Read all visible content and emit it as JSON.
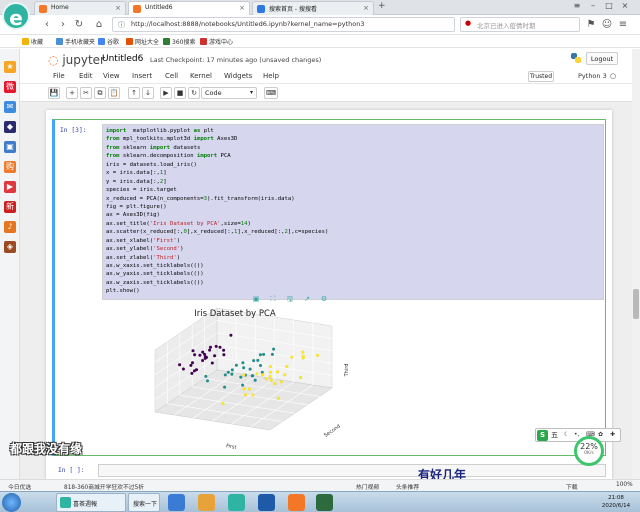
{
  "browser": {
    "tabs": [
      {
        "label": "Home",
        "active": false
      },
      {
        "label": "Untitled6",
        "active": true
      },
      {
        "label": "搜索首页 - 搜搜看",
        "active": false
      }
    ],
    "window_controls": [
      "≡",
      "–",
      "□",
      "×"
    ],
    "url": "http://localhost:8888/notebooks/Untitled6.ipynb?kernel_name=python3",
    "search_placeholder": "北京已进入疫情时期",
    "bookmarks": [
      {
        "label": "收藏",
        "color": "#f4b400"
      },
      {
        "label": "手机收藏夹",
        "color": "#4a90d9"
      },
      {
        "label": "谷歌",
        "color": "#4285f4"
      },
      {
        "label": "网址大全",
        "color": "#e65100"
      },
      {
        "label": "360搜索",
        "color": "#2e7d32"
      },
      {
        "label": "游戏中心",
        "color": "#d32f2f"
      }
    ]
  },
  "jupyter": {
    "logo_text": "jupyter",
    "notebook_title": "Untitled6",
    "checkpoint": "Last Checkpoint: 17 minutes ago (unsaved changes)",
    "logout_label": "Logout",
    "menu": [
      "File",
      "Edit",
      "View",
      "Insert",
      "Cell",
      "Kernel",
      "Widgets",
      "Help"
    ],
    "trusted_label": "Trusted",
    "kernel_label": "Python 3",
    "toolbar_icons": [
      {
        "name": "save-icon",
        "glyph": "💾"
      },
      {
        "name": "add-cell-icon",
        "glyph": "+"
      },
      {
        "name": "cut-icon",
        "glyph": "✂"
      },
      {
        "name": "copy-icon",
        "glyph": "⧉"
      },
      {
        "name": "paste-icon",
        "glyph": "📋"
      },
      {
        "name": "move-up-icon",
        "glyph": "↑"
      },
      {
        "name": "move-down-icon",
        "glyph": "↓"
      },
      {
        "name": "run-icon",
        "glyph": "▶"
      },
      {
        "name": "stop-icon",
        "glyph": "■"
      },
      {
        "name": "restart-icon",
        "glyph": "↻"
      }
    ],
    "cell_type": "Code"
  },
  "cell": {
    "prompt": "In  [3]:",
    "code": [
      [
        [
          "kw",
          "import"
        ],
        [
          "",
          "  matplotlib.pyplot "
        ],
        [
          "kw",
          "as"
        ],
        [
          "",
          " plt"
        ]
      ],
      [
        [
          "kw",
          "from"
        ],
        [
          "",
          " mpl_toolkits.mplot3d "
        ],
        [
          "kw",
          "import"
        ],
        [
          "",
          " Axes3D"
        ]
      ],
      [
        [
          "kw",
          "from"
        ],
        [
          "",
          " sklearn "
        ],
        [
          "kw",
          "import"
        ],
        [
          "",
          " datasets"
        ]
      ],
      [
        [
          "kw",
          "from"
        ],
        [
          "",
          " sklearn.decomposition "
        ],
        [
          "kw",
          "import"
        ],
        [
          "",
          " PCA"
        ]
      ],
      [
        [
          "",
          "iris = datasets.load_iris()"
        ]
      ],
      [
        [
          "",
          "x = iris.data[:,"
        ],
        [
          "num",
          "1"
        ],
        [
          "",
          "]"
        ]
      ],
      [
        [
          "",
          "y = iris.data[:,"
        ],
        [
          "num",
          "2"
        ],
        [
          "",
          "]"
        ]
      ],
      [
        [
          "",
          "species = iris.target"
        ]
      ],
      [
        [
          "",
          "x_reduced = PCA(n_components="
        ],
        [
          "num",
          "3"
        ],
        [
          "",
          ").fit_transform(iris.data)"
        ]
      ],
      [
        [
          "",
          "fig = plt.figure()"
        ]
      ],
      [
        [
          "",
          "ax = Axes3D(fig)"
        ]
      ],
      [
        [
          "",
          "ax.set_title("
        ],
        [
          "str",
          "'Iris Dataset by PCA'"
        ],
        [
          "",
          ",size="
        ],
        [
          "num",
          "14"
        ],
        [
          "",
          ")"
        ]
      ],
      [
        [
          "",
          "ax.scatter(x_reduced[:,"
        ],
        [
          "num",
          "0"
        ],
        [
          "",
          "],x_reduced[:,"
        ],
        [
          "num",
          "1"
        ],
        [
          "",
          "],x_reduced[:,"
        ],
        [
          "num",
          "2"
        ],
        [
          "",
          "],c=species)"
        ]
      ],
      [
        [
          "",
          "ax.set_xlabel("
        ],
        [
          "str",
          "'First'"
        ],
        [
          "",
          ")"
        ]
      ],
      [
        [
          "",
          "ax.set_ylabel("
        ],
        [
          "str",
          "'Second'"
        ],
        [
          "",
          ")"
        ]
      ],
      [
        [
          "",
          "ax.set_zlabel("
        ],
        [
          "str",
          "'Third'"
        ],
        [
          "",
          ")"
        ]
      ],
      [
        [
          "",
          "ax.w_xaxis.set_ticklabels(())"
        ]
      ],
      [
        [
          "",
          "ax.w_yaxis.set_ticklabels(())"
        ]
      ],
      [
        [
          "",
          "ax.w_zaxis.set_ticklabels(())"
        ]
      ],
      [
        [
          "",
          "plt.show()"
        ]
      ]
    ],
    "cell_tools": [
      "▣",
      "⛶",
      "🖫",
      "↗",
      "⚙"
    ]
  },
  "cell2": {
    "prompt": "In  [ ]:"
  },
  "chart_data": {
    "type": "scatter",
    "title": "Iris Dataset by PCA",
    "xlabel": "First",
    "ylabel": "Second",
    "zlabel": "Third",
    "ticklabels_hidden": true,
    "colors": {
      "class0": "#440154",
      "class1": "#21918c",
      "class2": "#fde725"
    },
    "series": [
      {
        "class": 0,
        "points": [
          [
            -2.68,
            0.32,
            -0.03
          ],
          [
            -2.71,
            -0.18,
            -0.21
          ],
          [
            -2.89,
            -0.14,
            0.02
          ],
          [
            -2.75,
            -0.32,
            0.03
          ],
          [
            -2.73,
            0.33,
            0.09
          ],
          [
            -2.28,
            0.74,
            0.17
          ],
          [
            -2.82,
            -0.09,
            0.26
          ],
          [
            -2.63,
            0.16,
            -0.02
          ],
          [
            -2.89,
            -0.58,
            0.02
          ],
          [
            -2.67,
            -0.11,
            -0.2
          ],
          [
            -2.51,
            0.65,
            -0.08
          ],
          [
            -2.61,
            0.01,
            0.22
          ],
          [
            -2.79,
            -0.24,
            -0.27
          ],
          [
            -3.23,
            -0.51,
            0.1
          ],
          [
            -2.64,
            1.18,
            -0.15
          ],
          [
            -2.38,
            1.34,
            0.28
          ],
          [
            -2.62,
            0.81,
            0.14
          ],
          [
            -2.65,
            0.31,
            0.03
          ],
          [
            -2.2,
            0.87,
            -0.12
          ],
          [
            -2.59,
            0.51,
            0.25
          ],
          [
            -2.31,
            0.39,
            -0.18
          ],
          [
            -2.54,
            0.43,
            0.2
          ],
          [
            -3.22,
            0.13,
            0.26
          ],
          [
            -2.3,
            0.1,
            0.13
          ],
          [
            -2.36,
            -0.04,
            0.36
          ]
        ]
      },
      {
        "class": 1,
        "points": [
          [
            1.28,
            0.69,
            0.41
          ],
          [
            0.93,
            0.32,
            0.02
          ],
          [
            1.46,
            0.5,
            0.34
          ],
          [
            0.18,
            -0.83,
            0.18
          ],
          [
            1.09,
            0.07,
            0.31
          ],
          [
            0.64,
            -0.42,
            -0.04
          ],
          [
            1.1,
            0.28,
            -0.17
          ],
          [
            -0.75,
            -1.0,
            -0.01
          ],
          [
            1.04,
            0.23,
            0.42
          ],
          [
            -0.01,
            -0.72,
            -0.28
          ],
          [
            -0.51,
            -1.26,
            0.27
          ],
          [
            0.51,
            -0.1,
            -0.13
          ],
          [
            0.26,
            -0.55,
            0.22
          ],
          [
            0.98,
            -0.12,
            -0.11
          ],
          [
            -0.17,
            -0.25,
            -0.09
          ],
          [
            0.93,
            0.47,
            0.31
          ],
          [
            0.66,
            -0.35,
            -0.33
          ],
          [
            0.23,
            -0.33,
            0.27
          ],
          [
            0.94,
            -0.54,
            0.5
          ],
          [
            0.04,
            -0.58,
            0.14
          ],
          [
            1.12,
            -0.08,
            -0.26
          ],
          [
            0.36,
            -0.07,
            0.08
          ],
          [
            1.3,
            -0.33,
            0.01
          ],
          [
            0.92,
            -0.18,
            0.13
          ],
          [
            0.71,
            0.15,
            0.24
          ]
        ]
      },
      {
        "class": 2,
        "points": [
          [
            2.53,
            -0.01,
            -0.76
          ],
          [
            1.41,
            -0.57,
            -0.3
          ],
          [
            2.62,
            0.34,
            0.11
          ],
          [
            1.97,
            -0.18,
            -0.1
          ],
          [
            2.35,
            -0.04,
            -0.29
          ],
          [
            3.4,
            0.55,
            0.35
          ],
          [
            0.52,
            -1.19,
            -0.55
          ],
          [
            2.93,
            0.35,
            0.43
          ],
          [
            2.32,
            -0.24,
            0.35
          ],
          [
            2.92,
            0.78,
            -0.42
          ],
          [
            1.66,
            0.24,
            -0.24
          ],
          [
            1.8,
            -0.22,
            0.04
          ],
          [
            2.17,
            0.22,
            -0.04
          ],
          [
            1.34,
            -0.78,
            -0.2
          ],
          [
            1.59,
            -0.54,
            -0.49
          ],
          [
            1.9,
            0.12,
            -0.29
          ],
          [
            1.95,
            0.04,
            0.01
          ],
          [
            3.49,
            1.18,
            0.16
          ],
          [
            3.8,
            0.26,
            0.57
          ],
          [
            1.3,
            -0.76,
            0.23
          ],
          [
            2.43,
            0.38,
            -0.19
          ],
          [
            1.2,
            -0.61,
            -0.48
          ],
          [
            3.5,
            0.46,
            0.59
          ],
          [
            1.39,
            -0.2,
            0.02
          ],
          [
            2.28,
            0.33,
            -0.4
          ]
        ]
      }
    ]
  },
  "overlay": {
    "left_text": "都跟我没有缘",
    "right_text": "有好几年",
    "ime_label": "五",
    "speed_pct": "22%",
    "speed_rate": "0K/s"
  },
  "statusbar": {
    "left": "今日优选",
    "news": "818-360商城开学狂欢不过5折",
    "right_items": [
      "热门视频",
      "头条推荐",
      "下载",
      "100%"
    ]
  },
  "taskbar": {
    "window_label": "喜茶週報",
    "search_label": "搜索一下",
    "time": "21:08",
    "date": "2020/6/14"
  },
  "side_icons": [
    {
      "name": "star-icon",
      "color": "#f6a623",
      "glyph": "★"
    },
    {
      "name": "weibo-icon",
      "color": "#e6162d",
      "glyph": "微"
    },
    {
      "name": "chat-icon",
      "color": "#3c8de0",
      "glyph": "✉"
    },
    {
      "name": "game-icon",
      "color": "#2a2a6e",
      "glyph": "◆"
    },
    {
      "name": "app-icon",
      "color": "#3f7cc9",
      "glyph": "▣"
    },
    {
      "name": "shop-icon",
      "color": "#f0792a",
      "glyph": "购"
    },
    {
      "name": "video-icon",
      "color": "#e0363d",
      "glyph": "▶"
    },
    {
      "name": "news-icon",
      "color": "#cc2020",
      "glyph": "新"
    },
    {
      "name": "music-icon",
      "color": "#e5761f",
      "glyph": "♪"
    },
    {
      "name": "game2-icon",
      "color": "#9b4a22",
      "glyph": "◈"
    }
  ]
}
